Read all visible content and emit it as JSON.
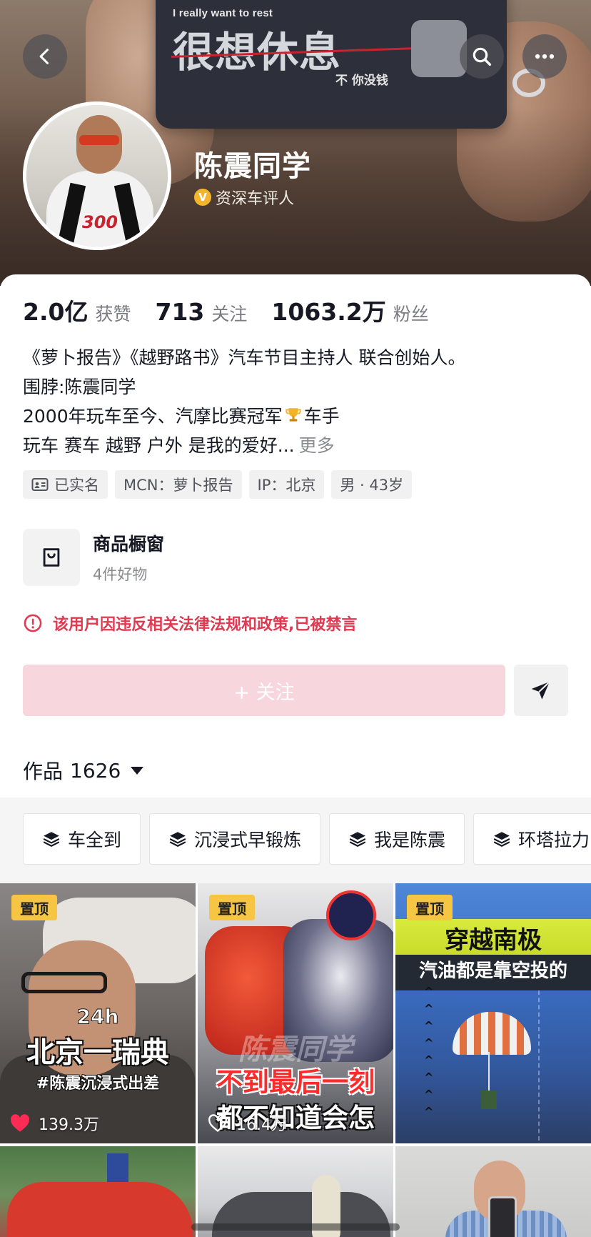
{
  "header": {
    "cover_text_small": "I really want to rest",
    "cover_text_large": "很想休息",
    "cover_text_note": "不 你没钱",
    "back_icon": "chevron-left-icon",
    "search_icon": "search-icon",
    "more_icon": "more-horizontal-icon"
  },
  "profile": {
    "name": "陈震同学",
    "verified_badge": "V",
    "verified_label": "资深车评人",
    "avatar_number": "300"
  },
  "stats": [
    {
      "value": "2.0亿",
      "label": "获赞"
    },
    {
      "value": "713",
      "label": "关注"
    },
    {
      "value": "1063.2万",
      "label": "粉丝"
    }
  ],
  "bio": {
    "line1": "《萝卜报告》《越野路书》汽车节目主持人 联合创始人。",
    "line2": "围脖:陈震同学",
    "line3_before": "2000年玩车至今、汽摩比赛冠军",
    "line3_after": "车手",
    "line4": "玩车 赛车 越野 户外 是我的爱好...",
    "more": "更多"
  },
  "tags": [
    {
      "label": "已实名",
      "icon": "id-card-icon"
    },
    {
      "label": "MCN：萝卜报告"
    },
    {
      "label": "IP：北京"
    },
    {
      "label": "男 · 43岁"
    }
  ],
  "shop": {
    "title": "商品橱窗",
    "subtitle": "4件好物",
    "icon": "shopping-bag-icon"
  },
  "ban_notice": {
    "text": "该用户因违反相关法律法规和政策,已被禁言",
    "icon": "alert-circle-icon",
    "color": "#e03a52"
  },
  "actions": {
    "follow_label": "+ 关注",
    "follow_bg": "#f7d6dd",
    "share_icon": "send-icon"
  },
  "works": {
    "label": "作品",
    "count": "1626"
  },
  "collections": [
    {
      "label": "车全到"
    },
    {
      "label": "沉浸式早锻炼"
    },
    {
      "label": "我是陈震"
    },
    {
      "label": "环塔拉力"
    }
  ],
  "videos": [
    {
      "pinned": "置顶",
      "likes": "139.3万",
      "liked": true,
      "cover_top": "24h",
      "cover_title": "北京一瑞典",
      "cover_tag": "#陈震沉浸式出差"
    },
    {
      "pinned": "置顶",
      "likes": "16.4万",
      "liked": false,
      "cover_watermark": "陈震同学",
      "cover_red": "不到最后一刻",
      "cover_white": "都不知道会怎"
    },
    {
      "pinned": "置顶",
      "cover_title": "穿越南极",
      "cover_sub": "汽油都是靠空投的"
    }
  ],
  "colors": {
    "pin_bg": "#f5c543",
    "like_red": "#fe2c55",
    "accent_text": "#161823"
  }
}
